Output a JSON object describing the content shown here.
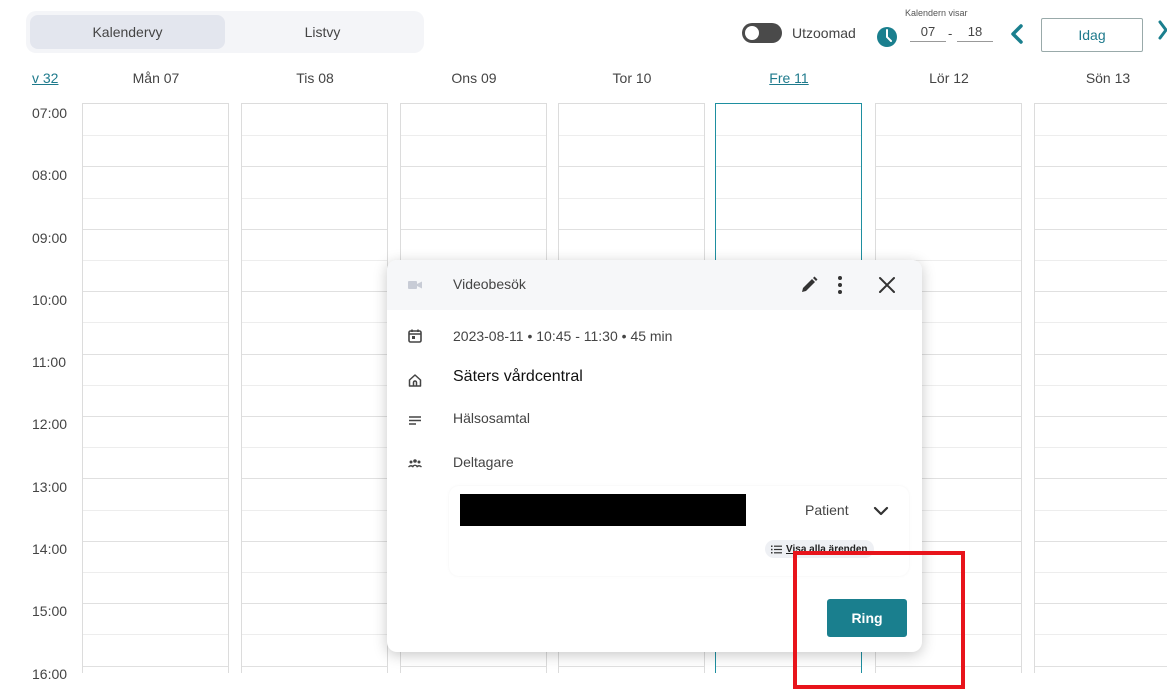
{
  "toolbar": {
    "views": [
      {
        "label": "Kalendervy",
        "active": true
      },
      {
        "label": "Listvy",
        "active": false
      }
    ],
    "zoom_label": "Utzoomad",
    "range_caption": "Kalendern visar",
    "range_from": "07",
    "range_sep": "-",
    "range_to": "18",
    "today_label": "Idag"
  },
  "week": {
    "number_label": "v 32",
    "days": [
      {
        "label": "Mån 07",
        "today": false
      },
      {
        "label": "Tis 08",
        "today": false
      },
      {
        "label": "Ons 09",
        "today": false
      },
      {
        "label": "Tor 10",
        "today": false
      },
      {
        "label": "Fre 11",
        "today": true
      },
      {
        "label": "Lör 12",
        "today": false
      },
      {
        "label": "Sön 13",
        "today": false
      }
    ],
    "hours": [
      "07:00",
      "08:00",
      "09:00",
      "10:00",
      "11:00",
      "12:00",
      "13:00",
      "14:00",
      "15:00",
      "16:00"
    ]
  },
  "popup": {
    "title": "Videobesök",
    "date": "2023-08-11",
    "time": "10:45 - 11:30",
    "duration": "45 min",
    "location": "Säters vårdcentral",
    "category": "Hälsosamtal",
    "participants_label": "Deltagare",
    "participant_role": "Patient",
    "show_all_label": "Visa alla ärenden",
    "ring_label": "Ring"
  },
  "colors": {
    "accent": "#1a7f8e",
    "highlight": "#e8141b"
  }
}
